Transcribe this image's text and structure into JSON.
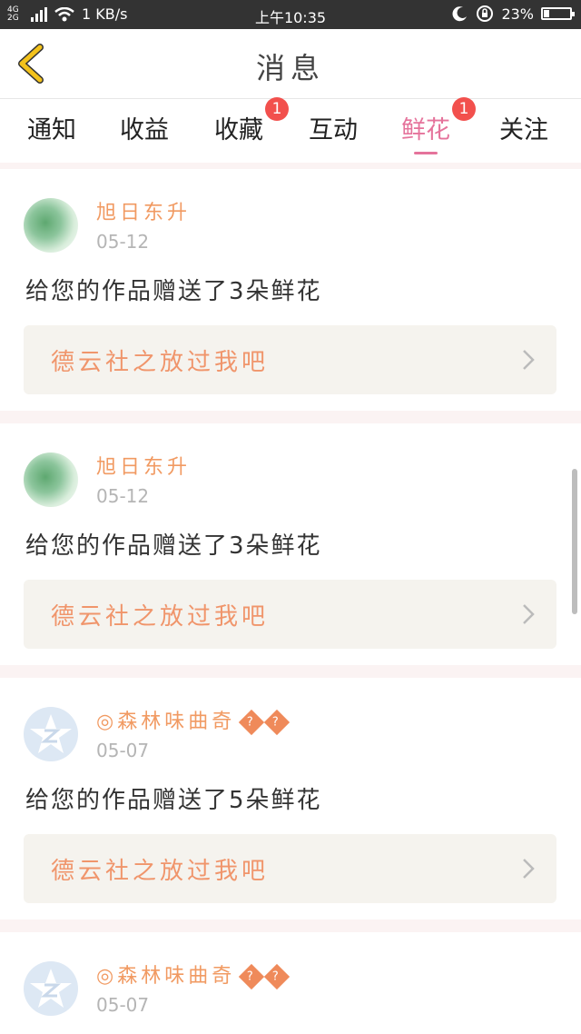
{
  "status_bar": {
    "network": "4G 2G",
    "speed": "1 KB/s",
    "time": "上午10:35",
    "battery": "23%",
    "battery_level": 0.23
  },
  "header": {
    "title": "消息"
  },
  "tabs": [
    {
      "label": "通知"
    },
    {
      "label": "收益"
    },
    {
      "label": "收藏",
      "badge": "1"
    },
    {
      "label": "互动"
    },
    {
      "label": "鲜花",
      "badge": "1",
      "active": true
    },
    {
      "label": "关注"
    }
  ],
  "messages": [
    {
      "user": "旭日东升",
      "date": "05-12",
      "text": "给您的作品赠送了3朵鲜花",
      "work_title": "德云社之放过我吧"
    },
    {
      "user": "旭日东升",
      "date": "05-12",
      "text": "给您的作品赠送了3朵鲜花",
      "work_title": "德云社之放过我吧"
    },
    {
      "user": "◎森林味曲奇",
      "date": "05-07",
      "text": "给您的作品赠送了5朵鲜花",
      "work_title": "德云社之放过我吧"
    },
    {
      "user": "◎森林味曲奇",
      "date": "05-07"
    }
  ],
  "colors": {
    "accent": "#e5739b",
    "name": "#f19a62",
    "badge": "#f2504d",
    "back_icon": "#f3c21b"
  },
  "icons": {
    "back": "chevron-left-icon",
    "item": "chevron-right-icon",
    "avatar_default": "z-logo-icon"
  }
}
